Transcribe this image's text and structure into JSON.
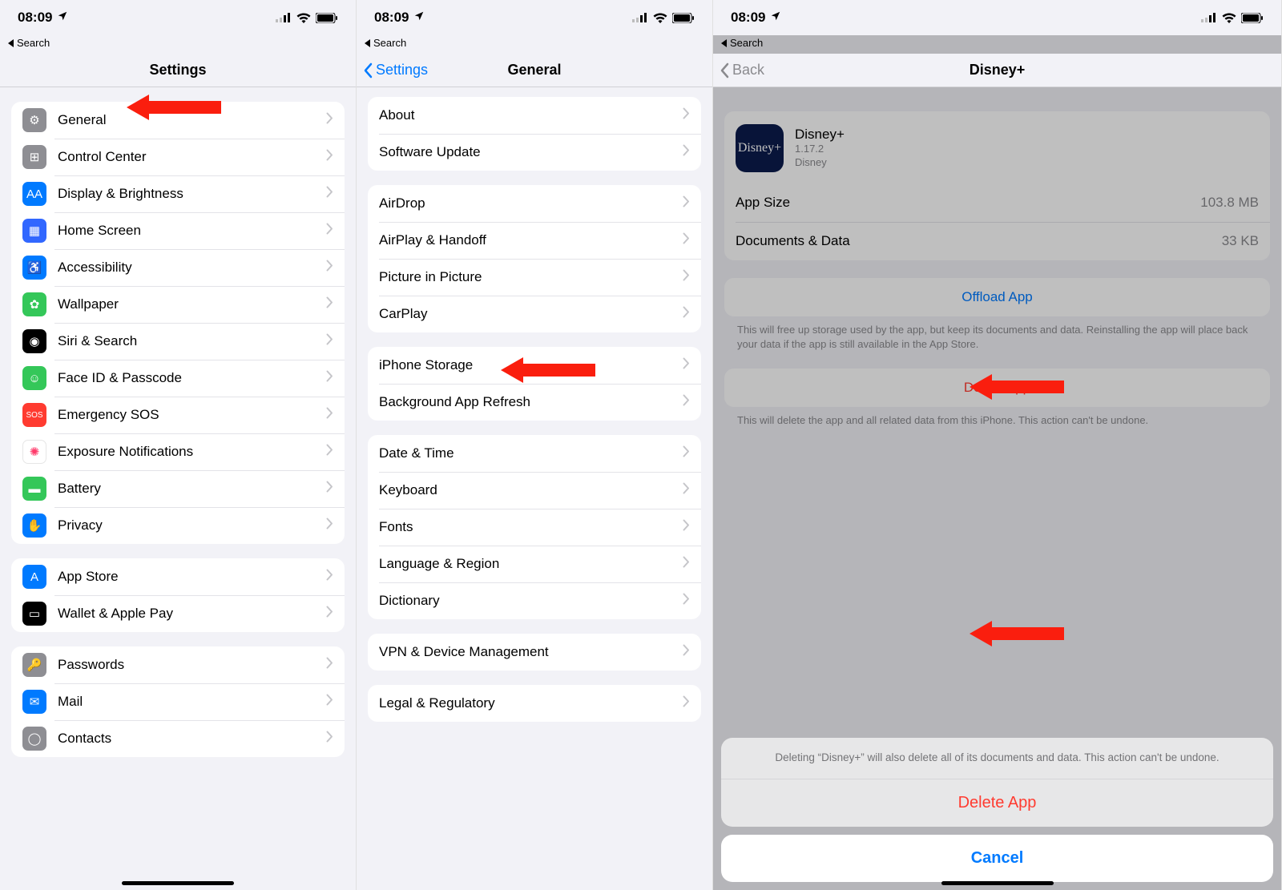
{
  "status": {
    "time": "08:09",
    "back_search": "Search"
  },
  "phone1": {
    "title": "Settings",
    "group1": [
      {
        "key": "general",
        "label": "General",
        "color": "ic-grey"
      },
      {
        "key": "control-center",
        "label": "Control Center",
        "color": "ic-grey"
      },
      {
        "key": "display-brightness",
        "label": "Display & Brightness",
        "color": "ic-blue"
      },
      {
        "key": "home-screen",
        "label": "Home Screen",
        "color": "ic-indigo"
      },
      {
        "key": "accessibility",
        "label": "Accessibility",
        "color": "ic-blue"
      },
      {
        "key": "wallpaper",
        "label": "Wallpaper",
        "color": "ic-teal"
      },
      {
        "key": "siri-search",
        "label": "Siri & Search",
        "color": "ic-black"
      },
      {
        "key": "faceid",
        "label": "Face ID & Passcode",
        "color": "ic-green"
      },
      {
        "key": "emergency-sos",
        "label": "Emergency SOS",
        "color": "ic-red"
      },
      {
        "key": "exposure",
        "label": "Exposure Notifications",
        "color": "ic-white"
      },
      {
        "key": "battery",
        "label": "Battery",
        "color": "ic-green"
      },
      {
        "key": "privacy",
        "label": "Privacy",
        "color": "ic-blue"
      }
    ],
    "group2": [
      {
        "key": "app-store",
        "label": "App Store",
        "color": "ic-blue"
      },
      {
        "key": "wallet",
        "label": "Wallet & Apple Pay",
        "color": "ic-black"
      }
    ],
    "group3": [
      {
        "key": "passwords",
        "label": "Passwords",
        "color": "ic-grey"
      },
      {
        "key": "mail",
        "label": "Mail",
        "color": "ic-blue"
      },
      {
        "key": "contacts",
        "label": "Contacts",
        "color": "ic-grey"
      }
    ]
  },
  "phone2": {
    "back": "Settings",
    "title": "General",
    "g1": [
      {
        "key": "about",
        "label": "About"
      },
      {
        "key": "software-update",
        "label": "Software Update"
      }
    ],
    "g2": [
      {
        "key": "airdrop",
        "label": "AirDrop"
      },
      {
        "key": "airplay-handoff",
        "label": "AirPlay & Handoff"
      },
      {
        "key": "pip",
        "label": "Picture in Picture"
      },
      {
        "key": "carplay",
        "label": "CarPlay"
      }
    ],
    "g3": [
      {
        "key": "iphone-storage",
        "label": "iPhone Storage"
      },
      {
        "key": "bg-refresh",
        "label": "Background App Refresh"
      }
    ],
    "g4": [
      {
        "key": "date-time",
        "label": "Date & Time"
      },
      {
        "key": "keyboard",
        "label": "Keyboard"
      },
      {
        "key": "fonts",
        "label": "Fonts"
      },
      {
        "key": "lang-region",
        "label": "Language & Region"
      },
      {
        "key": "dictionary",
        "label": "Dictionary"
      }
    ],
    "g5": [
      {
        "key": "vpn-device",
        "label": "VPN & Device Management"
      }
    ],
    "g6": [
      {
        "key": "legal",
        "label": "Legal & Regulatory"
      }
    ]
  },
  "phone3": {
    "back": "Back",
    "title": "Disney+",
    "app": {
      "name": "Disney+",
      "version": "1.17.2",
      "vendor": "Disney",
      "icon_text": "Disney+"
    },
    "info": [
      {
        "label": "App Size",
        "value": "103.8 MB"
      },
      {
        "label": "Documents & Data",
        "value": "33 KB"
      }
    ],
    "offload": {
      "label": "Offload App",
      "helper": "This will free up storage used by the app, but keep its documents and data. Reinstalling the app will place back your data if the app is still available in the App Store."
    },
    "delete": {
      "label": "Delete App",
      "helper": "This will delete the app and all related data from this iPhone. This action can't be undone."
    },
    "sheet": {
      "message": "Deleting “Disney+” will also delete all of its documents and data. This action can't be undone.",
      "delete": "Delete App",
      "cancel": "Cancel"
    }
  }
}
